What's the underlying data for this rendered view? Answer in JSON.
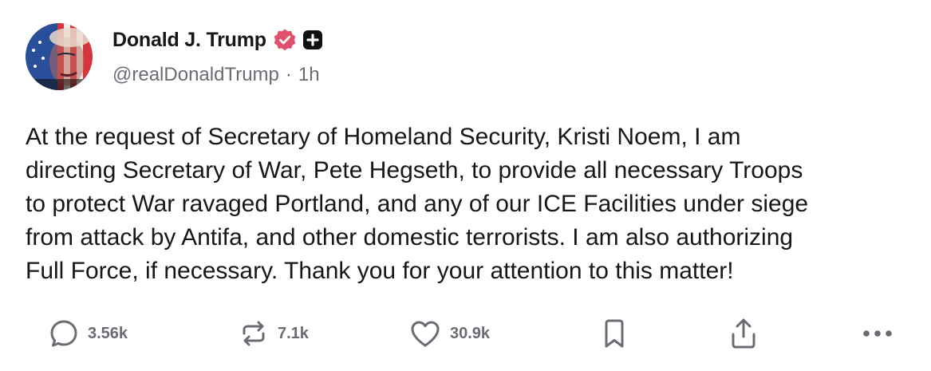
{
  "post": {
    "author": {
      "display_name": "Donald J. Trump",
      "handle": "@realDonaldTrump",
      "separator": "·",
      "time": "1h"
    },
    "badges": [
      "verified-badge-icon",
      "plus-badge-icon"
    ],
    "text": "At the request of Secretary of Homeland Security, Kristi Noem, I am\ndirecting Secretary of War, Pete Hegseth, to provide all necessary Troops\nto protect War ravaged Portland, and any of our ICE Facilities under siege\nfrom attack by Antifa, and other domestic terrorists. I am also authorizing\nFull Force, if necessary. Thank you for your attention to this matter!",
    "actions": {
      "replies": "3.56k",
      "reposts": "7.1k",
      "likes": "30.9k"
    },
    "colors": {
      "verified_badge": "#e0506a",
      "icon_gray": "#6b6b74",
      "text": "#171717"
    }
  }
}
